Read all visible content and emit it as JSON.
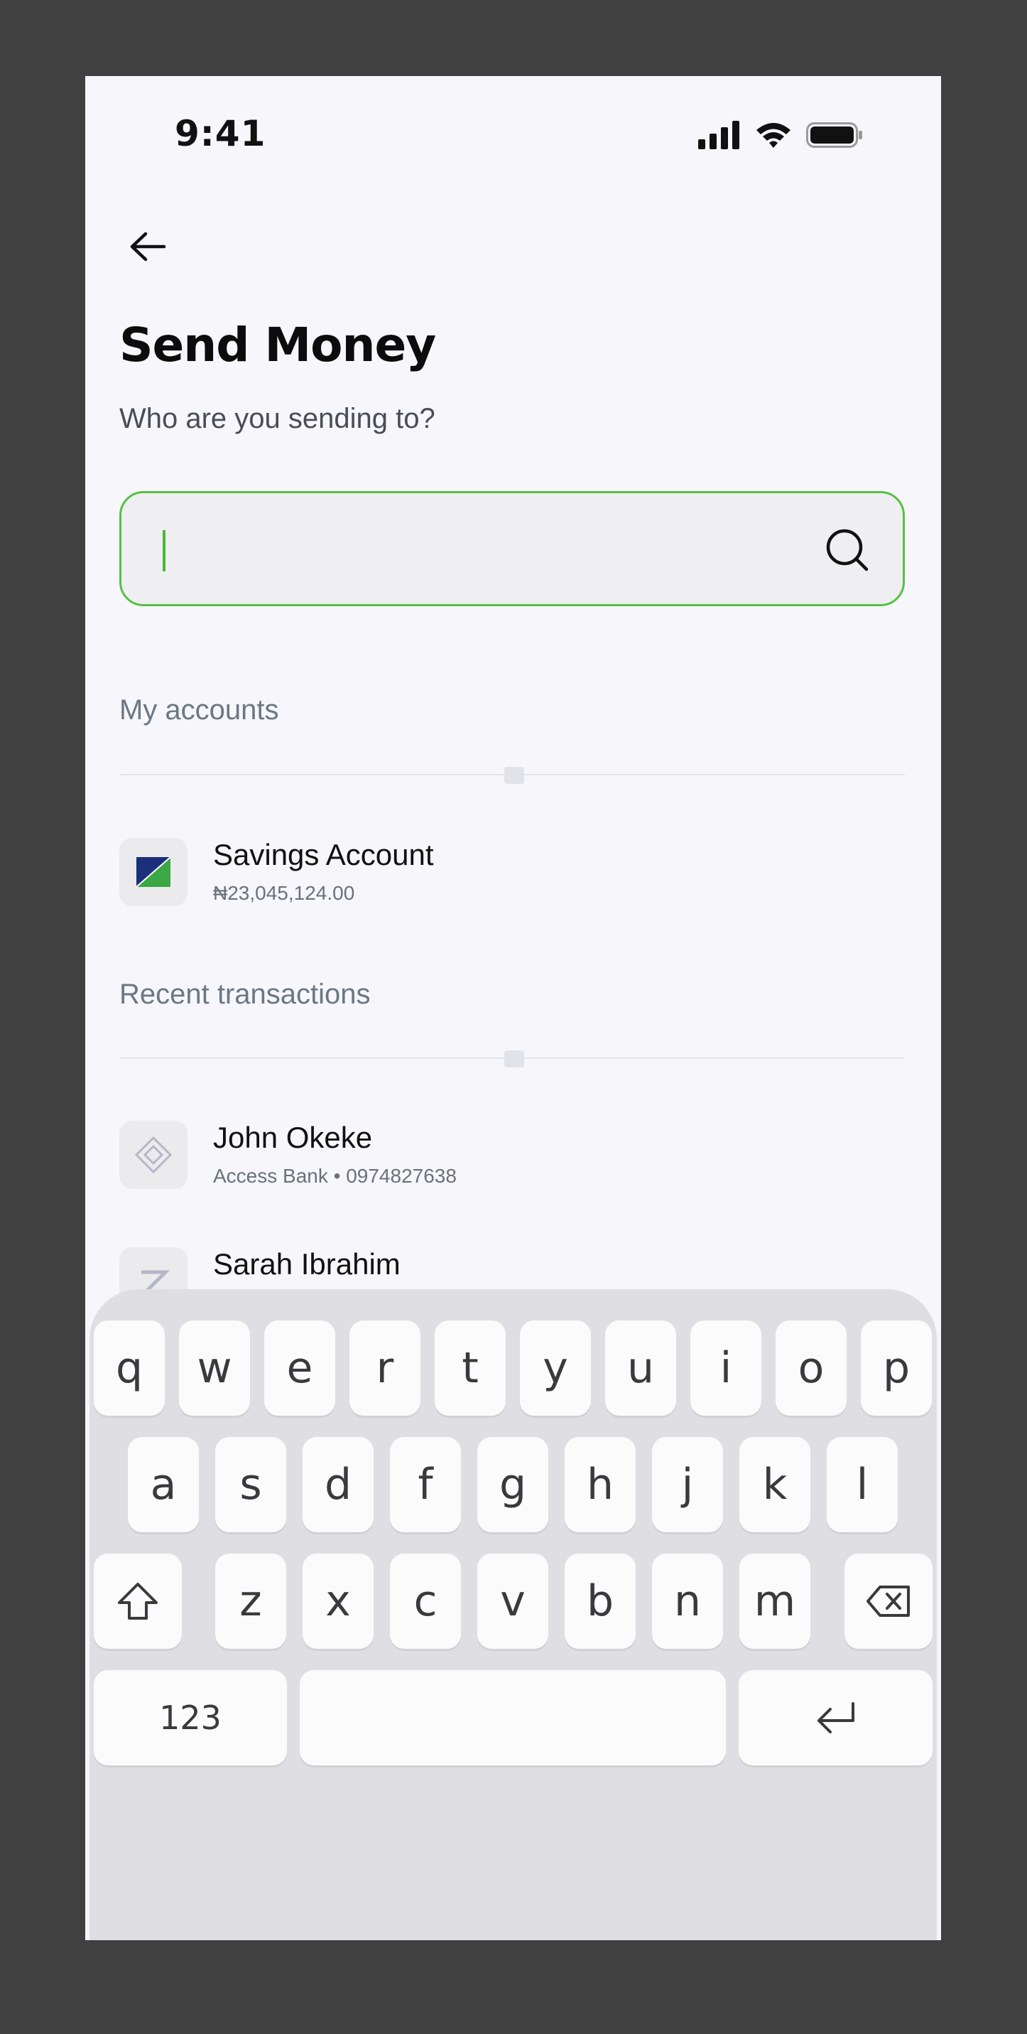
{
  "status_bar": {
    "time": "9:41"
  },
  "header": {
    "title": "Send Money",
    "subtitle": "Who are you sending to?"
  },
  "search": {
    "value": "",
    "placeholder": ""
  },
  "my_accounts": {
    "title": "My accounts",
    "items": [
      {
        "name": "Savings Account",
        "balance": "₦23,045,124.00"
      }
    ]
  },
  "recent": {
    "title": "Recent transactions",
    "items": [
      {
        "name": "John Okeke",
        "detail": "Access Bank • 0974827638"
      },
      {
        "name": "Sarah Ibrahim",
        "detail": ""
      }
    ]
  },
  "keyboard": {
    "row1": [
      "q",
      "w",
      "e",
      "r",
      "t",
      "y",
      "u",
      "i",
      "o",
      "p"
    ],
    "row2": [
      "a",
      "s",
      "d",
      "f",
      "g",
      "h",
      "j",
      "k",
      "l"
    ],
    "row3": [
      "z",
      "x",
      "c",
      "v",
      "b",
      "n",
      "m"
    ],
    "numbers_label": "123"
  },
  "colors": {
    "accent": "#56c145",
    "background": "#f6f6fb",
    "frame": "#404040"
  }
}
